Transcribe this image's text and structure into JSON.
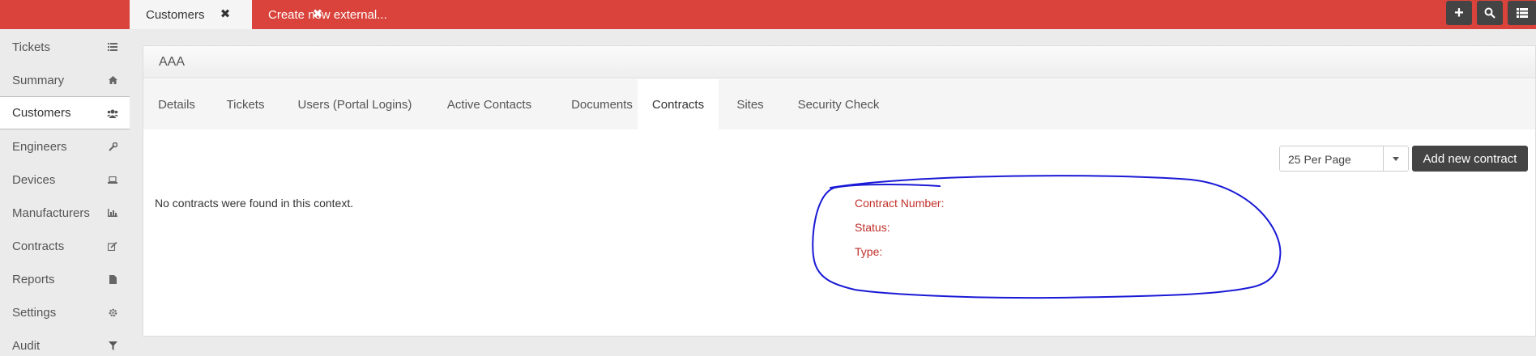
{
  "tabs": [
    {
      "label": "Customers"
    },
    {
      "label": "Create new external..."
    }
  ],
  "top_buttons": [
    {
      "icon": "plus-icon",
      "glyph": "+"
    },
    {
      "icon": "search-icon",
      "glyph": ""
    },
    {
      "icon": "list-icon",
      "glyph": ""
    }
  ],
  "sidebar": {
    "items": [
      {
        "label": "Tickets",
        "icon": "list-icon"
      },
      {
        "label": "Summary",
        "icon": "home-icon"
      },
      {
        "label": "Customers",
        "icon": "users-icon",
        "active": true
      },
      {
        "label": "Engineers",
        "icon": "wrench-icon"
      },
      {
        "label": "Devices",
        "icon": "laptop-icon"
      },
      {
        "label": "Manufacturers",
        "icon": "bar-chart-icon"
      },
      {
        "label": "Contracts",
        "icon": "edit-icon"
      },
      {
        "label": "Reports",
        "icon": "file-icon"
      },
      {
        "label": "Settings",
        "icon": "gear-icon"
      },
      {
        "label": "Audit",
        "icon": "filter-icon"
      }
    ]
  },
  "panel": {
    "title": "AAA",
    "tabs": [
      {
        "label": "Details"
      },
      {
        "label": "Tickets"
      },
      {
        "label": "Users (Portal Logins)"
      },
      {
        "label": "Active Contacts"
      },
      {
        "label": "Documents"
      },
      {
        "label": "Contracts",
        "active": true
      },
      {
        "label": "Sites"
      },
      {
        "label": "Security Check"
      }
    ],
    "per_page": "25 Per Page",
    "add_button": "Add new contract",
    "empty_message": "No contracts were found in this context.",
    "detail_labels": [
      "Contract Number:",
      "Status:",
      "Type:"
    ]
  },
  "colors": {
    "header_red": "#d9433b",
    "dark_button": "#444444",
    "label_red": "#c0302a",
    "annotation_blue": "#1a1ad6"
  }
}
